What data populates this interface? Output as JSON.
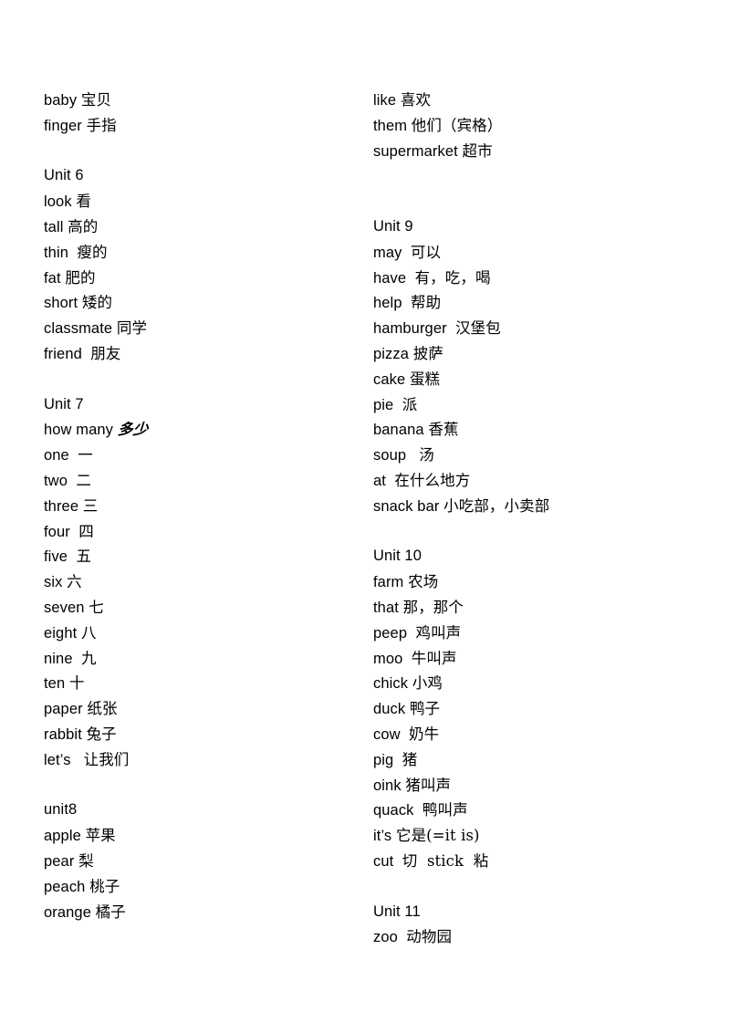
{
  "document": {
    "type": "vocabulary-list",
    "language_pair": "English-Chinese",
    "columns": [
      {
        "name": "left-column",
        "lines": [
          {
            "en": "baby",
            "gap": " ",
            "zh": "宝贝"
          },
          {
            "en": "finger",
            "gap": " ",
            "zh": "手指"
          },
          {
            "blank": true
          },
          {
            "heading": "Unit 6"
          },
          {
            "en": "look",
            "gap": " ",
            "zh": "看"
          },
          {
            "en": "tall",
            "gap": " ",
            "zh": "高的"
          },
          {
            "en": "thin",
            "gap": "  ",
            "zh": "瘦的"
          },
          {
            "en": "fat",
            "gap": " ",
            "zh": "肥的"
          },
          {
            "en": "short",
            "gap": " ",
            "zh": "矮的"
          },
          {
            "en": "classmate",
            "gap": " ",
            "zh": "同学"
          },
          {
            "en": "friend",
            "gap": "  ",
            "zh": "朋友"
          },
          {
            "blank": true
          },
          {
            "heading": "Unit 7"
          },
          {
            "en": "how many",
            "gap": " ",
            "zh": "多少",
            "script": true
          },
          {
            "en": "one",
            "gap": "  ",
            "zh": "一"
          },
          {
            "en": "two",
            "gap": "  ",
            "zh": "二"
          },
          {
            "en": "three",
            "gap": " ",
            "zh": "三"
          },
          {
            "en": "four",
            "gap": "  ",
            "zh": "四"
          },
          {
            "en": "five",
            "gap": "  ",
            "zh": "五"
          },
          {
            "en": "six",
            "gap": " ",
            "zh": "六"
          },
          {
            "en": "seven",
            "gap": " ",
            "zh": "七"
          },
          {
            "en": "eight",
            "gap": " ",
            "zh": "八"
          },
          {
            "en": "nine",
            "gap": "  ",
            "zh": "九"
          },
          {
            "en": "ten",
            "gap": " ",
            "zh": "十"
          },
          {
            "en": "paper",
            "gap": " ",
            "zh": "纸张"
          },
          {
            "en": "rabbit",
            "gap": " ",
            "zh": "兔子"
          },
          {
            "en": "let’s",
            "gap": "   ",
            "zh": "让我们"
          },
          {
            "blank": true
          },
          {
            "heading": "unit8"
          },
          {
            "en": "apple",
            "gap": " ",
            "zh": "苹果"
          },
          {
            "en": "pear",
            "gap": " ",
            "zh": "梨"
          },
          {
            "en": "peach",
            "gap": " ",
            "zh": "桃子"
          },
          {
            "en": "orange",
            "gap": " ",
            "zh": "橘子"
          }
        ]
      },
      {
        "name": "right-column",
        "lines": [
          {
            "en": "like",
            "gap": " ",
            "zh": "喜欢"
          },
          {
            "en": "them",
            "gap": " ",
            "zh": "他们（宾格）"
          },
          {
            "en": "supermarket",
            "gap": " ",
            "zh": "超市"
          },
          {
            "blank": true
          },
          {
            "blank": true
          },
          {
            "heading": "Unit 9"
          },
          {
            "en": "may",
            "gap": "  ",
            "zh": "可以"
          },
          {
            "en": "have",
            "gap": "  ",
            "zh": "有，吃，喝"
          },
          {
            "en": "help",
            "gap": "  ",
            "zh": "帮助"
          },
          {
            "en": "hamburger",
            "gap": "  ",
            "zh": "汉堡包"
          },
          {
            "en": "pizza",
            "gap": " ",
            "zh": "披萨"
          },
          {
            "en": "cake",
            "gap": " ",
            "zh": "蛋糕"
          },
          {
            "en": "pie",
            "gap": "  ",
            "zh": "派"
          },
          {
            "en": "banana",
            "gap": " ",
            "zh": "香蕉"
          },
          {
            "en": "soup",
            "gap": "   ",
            "zh": "汤"
          },
          {
            "en": "at",
            "gap": "  ",
            "zh": "在什么地方"
          },
          {
            "en": "snack bar",
            "gap": " ",
            "zh": "小吃部，小卖部"
          },
          {
            "blank": true
          },
          {
            "heading": "Unit 10"
          },
          {
            "en": "farm",
            "gap": " ",
            "zh": "农场"
          },
          {
            "en": "that",
            "gap": " ",
            "zh": "那，那个"
          },
          {
            "en": "peep",
            "gap": "  ",
            "zh": "鸡叫声"
          },
          {
            "en": "moo",
            "gap": "  ",
            "zh": "牛叫声"
          },
          {
            "en": "chick",
            "gap": " ",
            "zh": "小鸡"
          },
          {
            "en": "duck",
            "gap": " ",
            "zh": "鸭子"
          },
          {
            "en": "cow",
            "gap": "  ",
            "zh": "奶牛"
          },
          {
            "en": "pig",
            "gap": "  ",
            "zh": "猪"
          },
          {
            "en": "oink",
            "gap": " ",
            "zh": "猪叫声"
          },
          {
            "en": "quack",
            "gap": "  ",
            "zh": "鸭叫声"
          },
          {
            "en": "it’s",
            "gap": " ",
            "zh": "它是(=it is)"
          },
          {
            "en": "cut",
            "gap": "  ",
            "zh": "切  stick  粘"
          },
          {
            "blank": true
          },
          {
            "heading": "Unit 11"
          },
          {
            "en": "zoo",
            "gap": "  ",
            "zh": "动物园"
          }
        ]
      }
    ]
  }
}
